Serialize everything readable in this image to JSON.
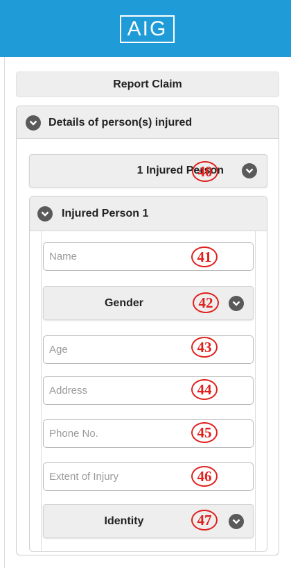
{
  "header": {
    "logo_text": "AIG",
    "bg_color": "#1f9bd8"
  },
  "report_claim": {
    "label": "Report Claim"
  },
  "section": {
    "title": "Details of person(s) injured"
  },
  "injured_count": {
    "selected": "1 Injured Person"
  },
  "person": {
    "title": "Injured Person 1",
    "name_placeholder": "Name",
    "gender_label": "Gender",
    "age_placeholder": "Age",
    "address_placeholder": "Address",
    "phone_placeholder": "Phone No.",
    "injury_placeholder": "Extent of Injury",
    "identity_label": "Identity"
  },
  "markers": {
    "m40": "40",
    "m41": "41",
    "m42": "42",
    "m43": "43",
    "m44": "44",
    "m45": "45",
    "m46": "46",
    "m47": "47"
  },
  "icons": {
    "dropdown": "chevron-down-icon"
  },
  "colors": {
    "marker": "#e0201c",
    "icon_circle": "#5a5a5a",
    "panel_bg": "#eeeeee"
  }
}
